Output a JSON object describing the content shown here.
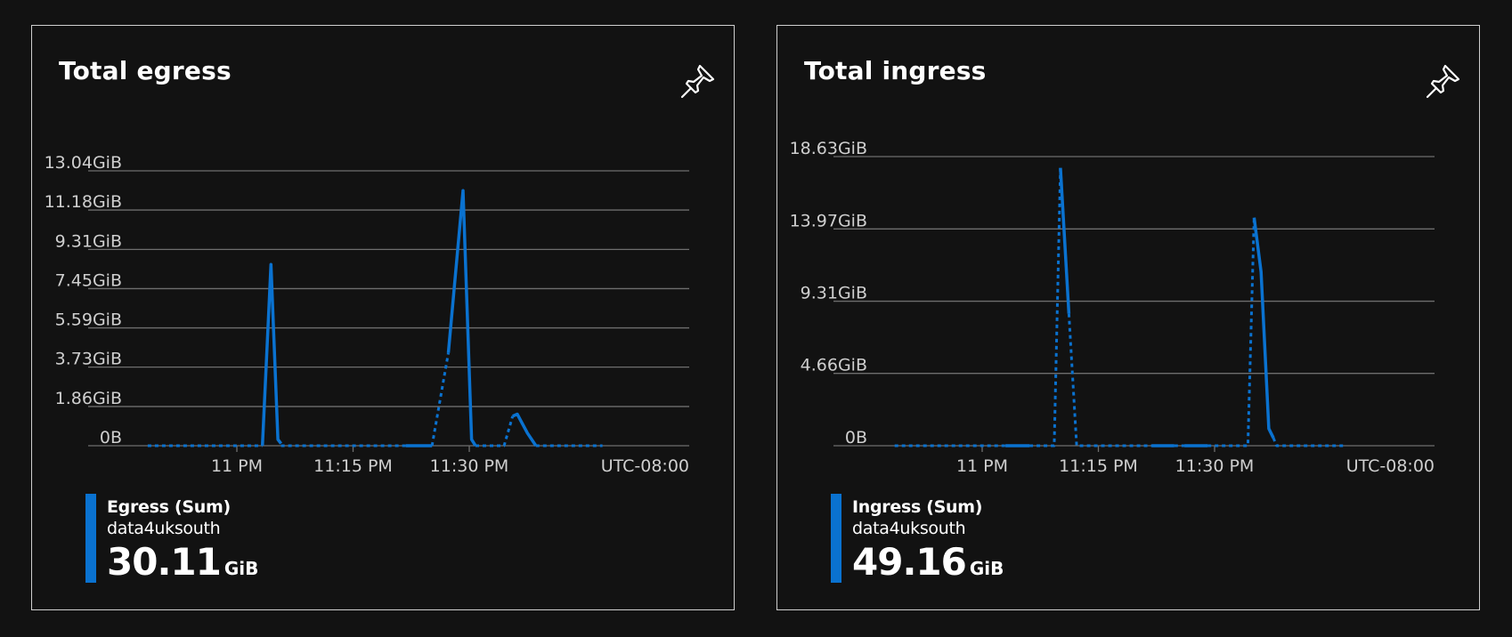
{
  "colors": {
    "background": "#121212",
    "border": "#cfcfcf",
    "series": "#0a72d0",
    "grid": "#6e6e6e",
    "text": "#ffffff",
    "axis_text": "#cfcfcf"
  },
  "cards": [
    {
      "title": "Total egress",
      "pin_icon": "pin-icon",
      "legend": {
        "name": "Egress (Sum)",
        "resource": "data4uksouth",
        "value": "30.11",
        "unit": "GiB"
      },
      "timezone": "UTC-08:00"
    },
    {
      "title": "Total ingress",
      "pin_icon": "pin-icon",
      "legend": {
        "name": "Ingress (Sum)",
        "resource": "data4uksouth",
        "value": "49.16",
        "unit": "GiB"
      },
      "timezone": "UTC-08:00"
    }
  ],
  "chart_data": [
    {
      "type": "line",
      "title": "Total egress",
      "x_unit": "minutes relative to 11 PM",
      "x_range": [
        -9.4,
        28.1
      ],
      "ylim": [
        0,
        13.04
      ],
      "y_ticks": [
        {
          "value": 0,
          "label": "0B"
        },
        {
          "value": 1.86,
          "label": "1.86GiB"
        },
        {
          "value": 3.73,
          "label": "3.73GiB"
        },
        {
          "value": 5.59,
          "label": "5.59GiB"
        },
        {
          "value": 7.45,
          "label": "7.45GiB"
        },
        {
          "value": 9.31,
          "label": "9.31GiB"
        },
        {
          "value": 11.18,
          "label": "11.18GiB"
        },
        {
          "value": 13.04,
          "label": "13.04GiB"
        }
      ],
      "x_ticks": [
        {
          "value": 0,
          "label": "11 PM"
        },
        {
          "value": 15,
          "label": "11:15 PM"
        },
        {
          "value": 30,
          "label": "11:30 PM"
        }
      ],
      "grid": true,
      "series": [
        {
          "name": "Egress (Sum)",
          "segments": [
            {
              "dashed": true,
              "points": [
                [
                  -11.5,
                  0
                ],
                [
                  3.3,
                  0
                ]
              ]
            },
            {
              "dashed": false,
              "points": [
                [
                  3.3,
                  0
                ],
                [
                  4.4,
                  8.6
                ],
                [
                  5.3,
                  0.3
                ],
                [
                  5.7,
                  0.1
                ]
              ]
            },
            {
              "dashed": true,
              "points": [
                [
                  5.7,
                  0
                ],
                [
                  21.8,
                  0
                ]
              ]
            },
            {
              "dashed": false,
              "points": [
                [
                  21.8,
                  0
                ],
                [
                  25.2,
                  0
                ]
              ]
            },
            {
              "dashed": true,
              "points": [
                [
                  25.2,
                  0
                ],
                [
                  27.3,
                  4.4
                ]
              ]
            },
            {
              "dashed": false,
              "points": [
                [
                  27.3,
                  4.4
                ],
                [
                  29.2,
                  12.1
                ],
                [
                  30.3,
                  0.3
                ],
                [
                  30.8,
                  0
                ]
              ]
            },
            {
              "dashed": true,
              "points": [
                [
                  30.8,
                  0
                ],
                [
                  34.5,
                  0
                ],
                [
                  35.6,
                  1.4
                ]
              ]
            },
            {
              "dashed": false,
              "points": [
                [
                  35.6,
                  1.4
                ],
                [
                  36.2,
                  1.5
                ],
                [
                  37.5,
                  0.6
                ],
                [
                  38.6,
                  0
                ]
              ]
            },
            {
              "dashed": true,
              "points": [
                [
                  38.6,
                  0
                ],
                [
                  47.2,
                  0
                ]
              ]
            }
          ]
        }
      ],
      "timezone": "UTC-08:00"
    },
    {
      "type": "line",
      "title": "Total ingress",
      "x_unit": "minutes relative to 11 PM",
      "ylim": [
        0,
        18.63
      ],
      "y_ticks": [
        {
          "value": 0,
          "label": "0B"
        },
        {
          "value": 4.66,
          "label": "4.66GiB"
        },
        {
          "value": 9.31,
          "label": "9.31GiB"
        },
        {
          "value": 13.97,
          "label": "13.97GiB"
        },
        {
          "value": 18.63,
          "label": "18.63GiB"
        }
      ],
      "x_ticks": [
        {
          "value": 0,
          "label": "11 PM"
        },
        {
          "value": 15,
          "label": "11:15 PM"
        },
        {
          "value": 30,
          "label": "11:30 PM"
        }
      ],
      "grid": true,
      "series": [
        {
          "name": "Ingress (Sum)",
          "segments": [
            {
              "dashed": true,
              "points": [
                [
                  -11.3,
                  0
                ],
                [
                  3.0,
                  0
                ]
              ]
            },
            {
              "dashed": false,
              "points": [
                [
                  3.0,
                  0
                ],
                [
                  6.1,
                  0
                ]
              ]
            },
            {
              "dashed": true,
              "points": [
                [
                  6.1,
                  0
                ],
                [
                  9.3,
                  0
                ],
                [
                  10.1,
                  17.9
                ]
              ]
            },
            {
              "dashed": false,
              "points": [
                [
                  10.1,
                  17.9
                ],
                [
                  11.2,
                  8.5
                ]
              ]
            },
            {
              "dashed": true,
              "points": [
                [
                  11.2,
                  8.5
                ],
                [
                  12.2,
                  0
                ],
                [
                  21.9,
                  0
                ]
              ]
            },
            {
              "dashed": false,
              "points": [
                [
                  21.9,
                  0
                ],
                [
                  24.8,
                  0
                ]
              ]
            },
            {
              "dashed": true,
              "points": [
                [
                  24.8,
                  0
                ],
                [
                  26.1,
                  0
                ]
              ]
            },
            {
              "dashed": false,
              "points": [
                [
                  26.1,
                  0
                ],
                [
                  29.1,
                  0
                ]
              ]
            },
            {
              "dashed": true,
              "points": [
                [
                  29.1,
                  0
                ],
                [
                  34.3,
                  0
                ],
                [
                  35.1,
                  14.7
                ]
              ]
            },
            {
              "dashed": false,
              "points": [
                [
                  35.1,
                  14.7
                ],
                [
                  36.0,
                  11.2
                ],
                [
                  37.0,
                  1.1
                ],
                [
                  37.6,
                  0.5
                ]
              ]
            },
            {
              "dashed": true,
              "points": [
                [
                  37.6,
                  0.5
                ],
                [
                  38.0,
                  0
                ],
                [
                  46.8,
                  0
                ]
              ]
            }
          ]
        }
      ],
      "timezone": "UTC-08:00"
    }
  ]
}
